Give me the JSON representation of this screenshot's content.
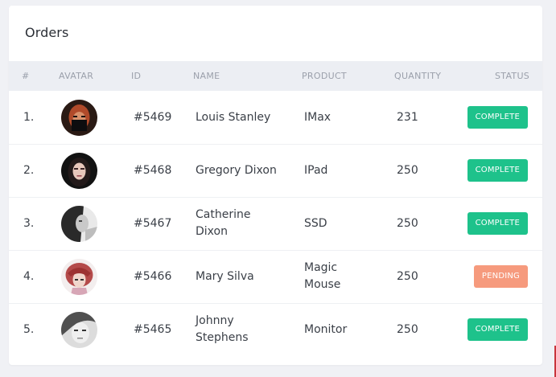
{
  "card": {
    "title": "Orders"
  },
  "table": {
    "headers": {
      "index": "#",
      "avatar": "AVATAR",
      "id": "ID",
      "name": "NAME",
      "product": "PRODUCT",
      "quantity": "QUANTITY",
      "status": "STATUS"
    },
    "rows": [
      {
        "index": "1.",
        "id": "#5469",
        "name": "Louis Stanley",
        "product": "IMax",
        "quantity": "231",
        "status": "COMPLETE",
        "status_color": "#1ec28b"
      },
      {
        "index": "2.",
        "id": "#5468",
        "name": "Gregory Dixon",
        "product": "IPad",
        "quantity": "250",
        "status": "COMPLETE",
        "status_color": "#1ec28b"
      },
      {
        "index": "3.",
        "id": "#5467",
        "name": "Catherine Dixon",
        "product": "SSD",
        "quantity": "250",
        "status": "COMPLETE",
        "status_color": "#1ec28b"
      },
      {
        "index": "4.",
        "id": "#5466",
        "name": "Mary Silva",
        "product": "Magic Mouse",
        "quantity": "250",
        "status": "PENDING",
        "status_color": "#f69a7d"
      },
      {
        "index": "5.",
        "id": "#5465",
        "name": "Johnny Stephens",
        "product": "Monitor",
        "quantity": "250",
        "status": "COMPLETE",
        "status_color": "#1ec28b"
      }
    ]
  },
  "colors": {
    "complete": "#1ec28b",
    "pending": "#f69a7d",
    "header_bg": "#eceef3"
  }
}
